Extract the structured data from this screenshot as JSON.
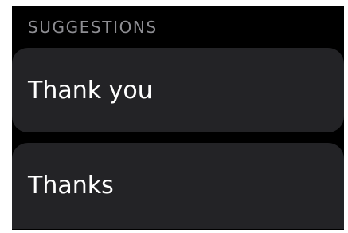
{
  "suggestions": {
    "header": "SUGGESTIONS",
    "items": [
      {
        "label": "Thank you"
      },
      {
        "label": "Thanks"
      }
    ]
  },
  "colors": {
    "background": "#000000",
    "card": "#232326",
    "header_text": "#8e8e93",
    "label_text": "#ffffff"
  }
}
